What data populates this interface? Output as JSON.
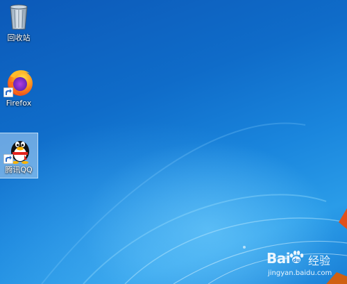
{
  "desktop": {
    "icons": [
      {
        "label": "回收站",
        "icon": "recycle-bin-icon",
        "selected": false
      },
      {
        "label": "Firefox",
        "icon": "firefox-icon",
        "selected": false
      },
      {
        "label": "腾讯QQ",
        "icon": "qq-penguin-icon",
        "selected": true
      }
    ]
  },
  "watermark": {
    "brand": "Bai",
    "suffix": "经验",
    "url": "jingyan.baidu.com"
  },
  "colors": {
    "wallpaper_dark": "#0c59b8",
    "wallpaper_light": "#2a9ce8",
    "selection": "#b4d7f5",
    "firefox_orange": "#ff7a1a",
    "firefox_purple": "#7b2fd0"
  }
}
